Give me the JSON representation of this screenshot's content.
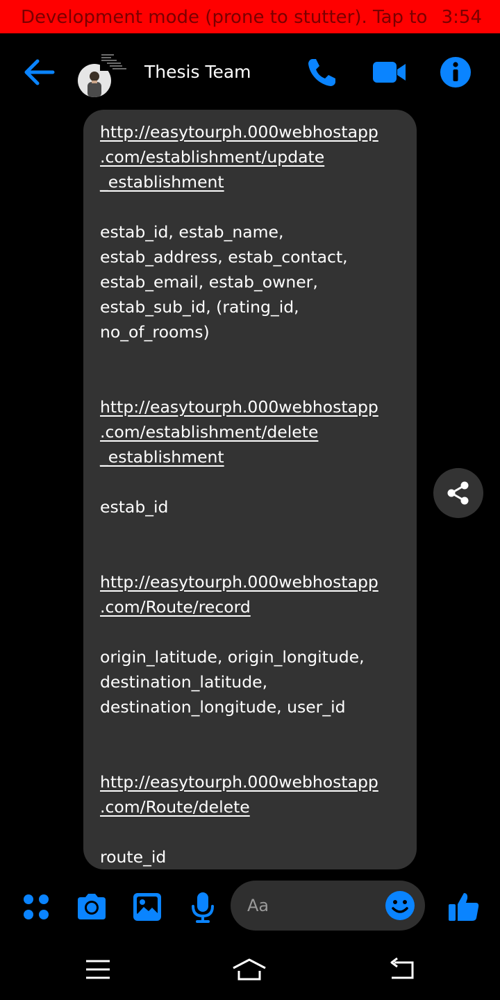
{
  "status_bar": {
    "dev_message": "Development mode (prone to stutter). Tap to ...",
    "time": "3:54"
  },
  "header": {
    "title": "Thesis Team"
  },
  "colors": {
    "accent": "#0a84ff",
    "bubble": "#333333",
    "dev_bar": "#ff0000"
  },
  "message": {
    "blocks": [
      {
        "link": "http://easytourph.000webhostapp.com/establishment/update_establishment",
        "link_lines": [
          "http://easytourph.000webhostapp",
          ".com/establishment/update",
          "_establishment"
        ],
        "params": "estab_id, estab_name,\nestab_address, estab_contact,\nestab_email, estab_owner,\nestab_sub_id, (rating_id,\nno_of_rooms)"
      },
      {
        "link": "http://easytourph.000webhostapp.com/establishment/delete_establishment",
        "link_lines": [
          "http://easytourph.000webhostapp",
          ".com/establishment/delete",
          "_establishment"
        ],
        "params": "estab_id"
      },
      {
        "link": "http://easytourph.000webhostapp.com/Route/record",
        "link_lines": [
          "http://easytourph.000webhostapp",
          ".com/Route/record"
        ],
        "params": "origin_latitude, origin_longitude,\ndestination_latitude,\ndestination_longitude, user_id"
      },
      {
        "link": "http://easytourph.000webhostapp.com/Route/delete",
        "link_lines": [
          "http://easytourph.000webhostapp",
          ".com/Route/delete"
        ],
        "params": "route_id"
      }
    ]
  },
  "composer": {
    "placeholder": "Aa",
    "icons": [
      "menu-dots-icon",
      "camera-icon",
      "gallery-icon",
      "microphone-icon",
      "emoji-icon",
      "thumbs-up-icon"
    ]
  },
  "navigation": {
    "icons": [
      "recents-icon",
      "home-icon",
      "back-nav-icon"
    ]
  }
}
